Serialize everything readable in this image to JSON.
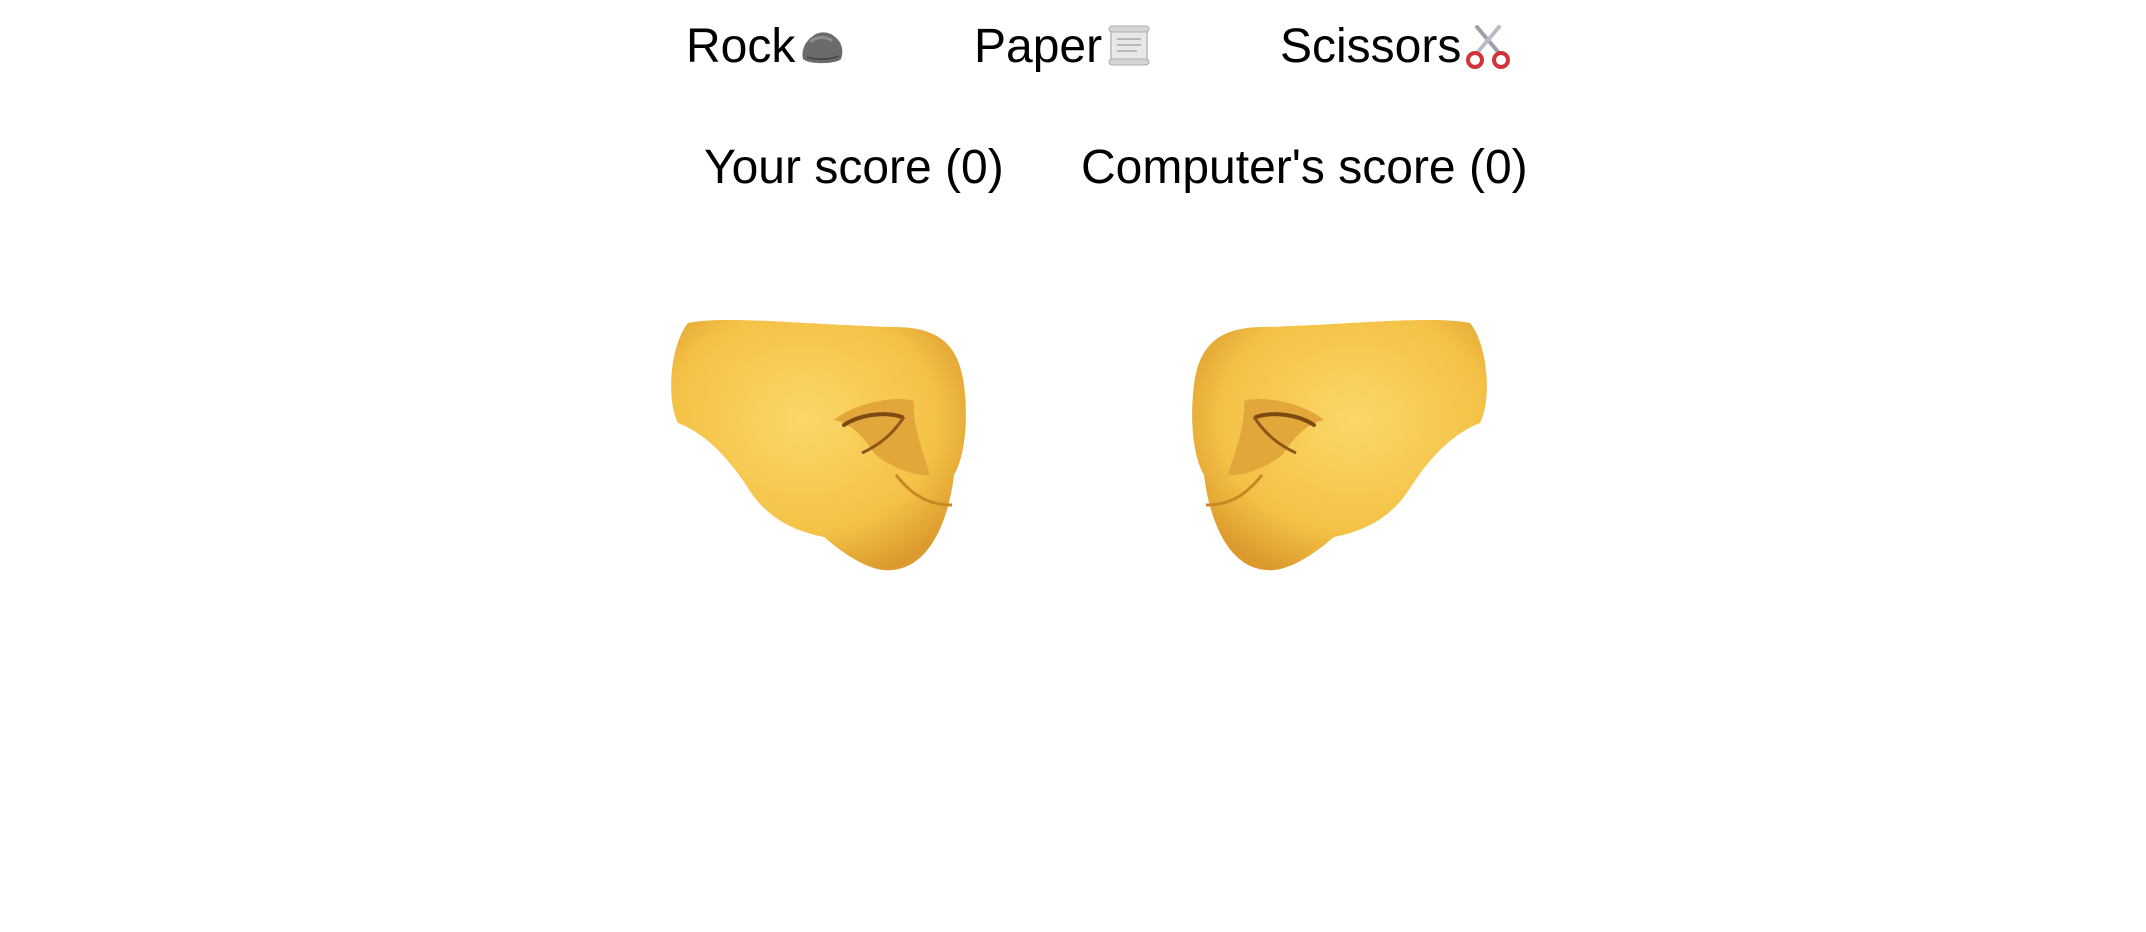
{
  "choices": [
    {
      "label": "Rock",
      "icon": "rock-icon"
    },
    {
      "label": "Paper",
      "icon": "scroll-icon"
    },
    {
      "label": "Scissors",
      "icon": "scissors-icon"
    }
  ],
  "scores": {
    "player": "Your score (0)",
    "computer": "Computer's score (0)"
  },
  "hands": {
    "player_hand_icon": "left-facing-fist-icon",
    "computer_hand_icon": "right-facing-fist-icon"
  },
  "colors": {
    "fist_yellow": "#F7C948",
    "fist_shadow": "#D9962E",
    "rock_gray": "#6B6B6B"
  }
}
